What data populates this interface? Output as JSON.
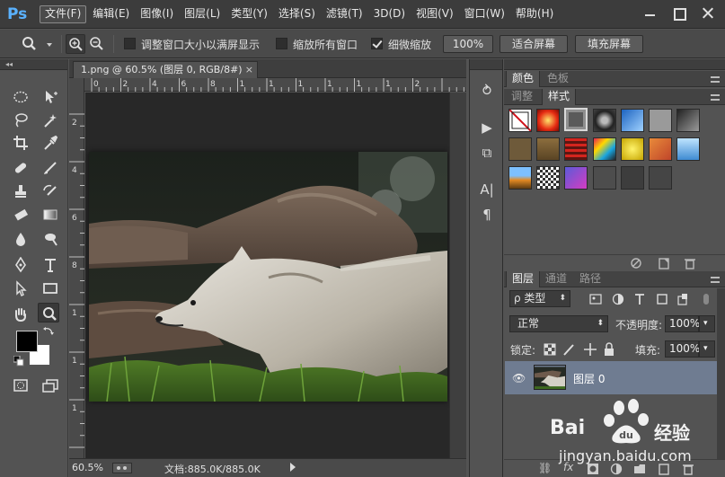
{
  "app": {
    "logo": "Ps"
  },
  "menu": [
    "文件(F)",
    "编辑(E)",
    "图像(I)",
    "图层(L)",
    "类型(Y)",
    "选择(S)",
    "滤镜(T)",
    "3D(D)",
    "视图(V)",
    "窗口(W)",
    "帮助(H)"
  ],
  "options": {
    "resize_windows_label": "调整窗口大小以满屏显示",
    "resize_windows_checked": false,
    "zoom_all_label": "缩放所有窗口",
    "zoom_all_checked": false,
    "scrubby_zoom_label": "细微缩放",
    "scrubby_zoom_checked": true,
    "btn_100": "100%",
    "btn_fit": "适合屏幕",
    "btn_fill": "填充屏幕"
  },
  "document": {
    "tab_title": "1.png @ 60.5% (图层 0, RGB/8#)",
    "tab_close": "×",
    "ruler_h": [
      "0",
      "2",
      "4",
      "6",
      "8",
      "1",
      "1",
      "1",
      "1",
      "1",
      "1",
      "2"
    ],
    "ruler_v": [
      "2",
      "4",
      "6",
      "8",
      "1",
      "1",
      "1"
    ]
  },
  "status": {
    "zoom": "60.5%",
    "doc_size": "文档:885.0K/885.0K"
  },
  "panels": {
    "top_tabs": [
      "颜色",
      "色板"
    ],
    "second_tabs": [
      "调整",
      "样式"
    ],
    "layers_tabs": [
      "图层",
      "通道",
      "路径"
    ],
    "layers_filter": "ρ 类型",
    "blend_mode": "正常",
    "opacity_label": "不透明度:",
    "opacity_value": "100%",
    "lock_label": "锁定:",
    "fill_label": "填充:",
    "fill_value": "100%",
    "layer_name": "图层 0"
  },
  "icons": {
    "tools": [
      "marquee-icon",
      "move-icon",
      "lasso-icon",
      "magic-wand-icon",
      "crop-icon",
      "eyedropper-icon",
      "healing-brush-icon",
      "brush-icon",
      "clone-stamp-icon",
      "history-brush-icon",
      "eraser-icon",
      "gradient-icon",
      "blur-icon",
      "dodge-icon",
      "pen-icon",
      "type-icon",
      "path-selection-icon",
      "rectangle-icon",
      "hand-icon",
      "zoom-icon"
    ]
  },
  "watermark": {
    "brand": "Bai",
    "brand2": "经验",
    "url": "jingyan.baidu.com"
  }
}
